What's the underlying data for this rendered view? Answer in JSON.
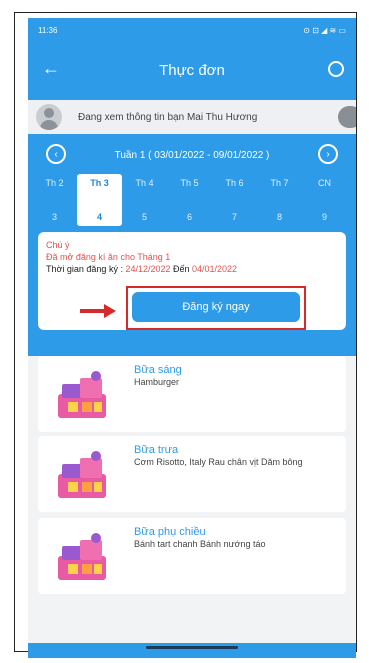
{
  "status_bar": {
    "time": "11:36",
    "icons": "⊙ ⊡ ◢ ≋ ▭"
  },
  "nav": {
    "title": "Thực đơn",
    "back_icon": "←",
    "history_icon": "history-icon"
  },
  "viewing": {
    "text": "Đang xem thông tin bạn Mai Thu Hương"
  },
  "week": {
    "label": "Tuần 1 ( 03/01/2022 - 09/01/2022 )",
    "prev": "‹",
    "next": "›"
  },
  "days": [
    {
      "name": "Th 2",
      "num": "3"
    },
    {
      "name": "Th 3",
      "num": "4",
      "selected": true
    },
    {
      "name": "Th 4",
      "num": "5"
    },
    {
      "name": "Th 5",
      "num": "6"
    },
    {
      "name": "Th 6",
      "num": "7"
    },
    {
      "name": "Th 7",
      "num": "8"
    },
    {
      "name": "CN",
      "num": "9"
    }
  ],
  "notice": {
    "line1": "Chú ý",
    "line2": "Đã mở đăng kí ăn cho Tháng 1",
    "line3_prefix": "Thời gian đăng ký : ",
    "start": "24/12/2022",
    "mid": " Đến ",
    "end": "04/01/2022",
    "button": "Đăng ký ngay"
  },
  "meals": [
    {
      "name": "Bữa sáng",
      "desc": "Hamburger"
    },
    {
      "name": "Bữa trưa",
      "desc": "Cơm Risotto, Italy Rau chân vịt Dăm bông"
    },
    {
      "name": "Bữa phụ chiều",
      "desc": "Bánh tart chanh Bánh nướng táo"
    }
  ],
  "colors": {
    "primary": "#2e9be8",
    "accent": "#e0534f",
    "annotation": "#d62a2a"
  }
}
